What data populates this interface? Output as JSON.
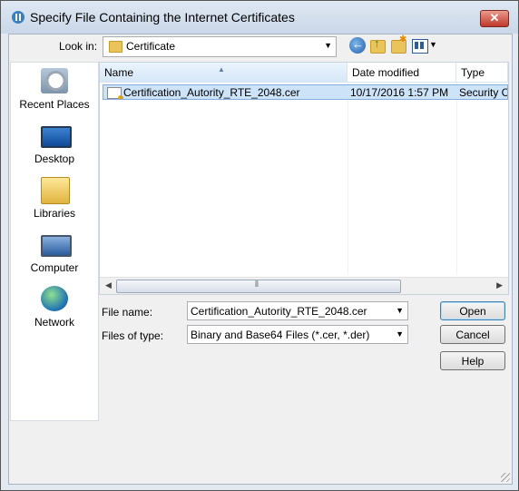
{
  "window": {
    "title": "Specify File Containing the Internet Certificates",
    "close_label": "✕"
  },
  "look_in": {
    "label": "Look in:",
    "value": "Certificate"
  },
  "places": [
    {
      "label": "Recent Places",
      "icon": "recent-places-icon"
    },
    {
      "label": "Desktop",
      "icon": "desktop-icon"
    },
    {
      "label": "Libraries",
      "icon": "libraries-icon"
    },
    {
      "label": "Computer",
      "icon": "computer-icon"
    },
    {
      "label": "Network",
      "icon": "network-icon"
    }
  ],
  "file_list": {
    "columns": [
      "Name",
      "Date modified",
      "Type"
    ],
    "rows": [
      {
        "name": "Certification_Autority_RTE_2048.cer",
        "date": "10/17/2016 1:57 PM",
        "type": "Security C"
      }
    ]
  },
  "file_name": {
    "label": "File name:",
    "value": "Certification_Autority_RTE_2048.cer"
  },
  "file_type": {
    "label": "Files of type:",
    "value": "Binary and Base64 Files (*.cer, *.der)"
  },
  "buttons": {
    "open": "Open",
    "cancel": "Cancel",
    "help": "Help"
  },
  "icons": {
    "combo_arrow": "▼",
    "scroll_left": "◀",
    "scroll_right": "▶",
    "grip": "⦀"
  },
  "colors": {
    "title_bar": "#dfe8f3",
    "selection": "#cde3f7",
    "close": "#c0392b"
  }
}
